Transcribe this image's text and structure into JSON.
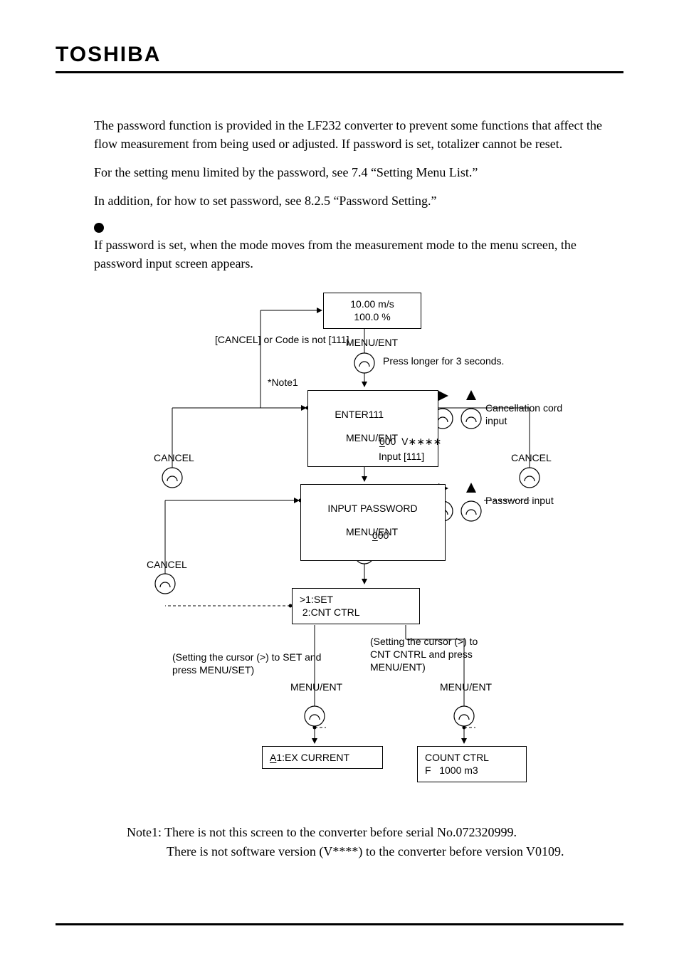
{
  "brand": "TOSHIBA",
  "para1": "The password function is provided in the LF232 converter to prevent some functions that affect the flow measurement from being used or adjusted. If password is set, totalizer cannot be reset.",
  "para2": "For the setting menu limited by the password, see 7.4 “Setting Menu List.”",
  "para3": "In addition, for how to set password, see 8.2.5 “Password Setting.”",
  "para4": "If password is set, when the mode moves from the measurement mode to the menu screen, the password input screen appears.",
  "diagram": {
    "display_top": "10.00 m/s\n100.0 %",
    "menu_ent": "MENU/ENT",
    "press_longer": "Press longer for\n3 seconds.",
    "cancel_note": "[CANCEL] or\nCode is not [111]",
    "note1_ref": "*Note1",
    "enter111": "ENTER111",
    "triple_zero": "000",
    "vstars": "V∗∗∗∗",
    "cancel_cord": "Cancellation\ncord input",
    "cancel": "CANCEL",
    "input111": "Input [111]",
    "input_password": "INPUT PASSWORD",
    "password_input": "Password\ninput",
    "menu_box": ">1:SET\n 2:CNT CTRL",
    "set_cursor_set": "(Setting the cursor (>) to SET\nand press MENU/SET)",
    "set_cursor_cnt": "(Setting the cursor (>)\nto CNT CNTRL and\npress MENU/ENT)",
    "a1_ex": "A1:EX CURRENT",
    "a1_under": "A",
    "count_ctrl": "COUNT CTRL\nF   1000 m3"
  },
  "footnote_l1": "Note1: There is not this screen to the converter before serial No.072320999.",
  "footnote_l2": "There is not software version (V****) to the converter before version V0109."
}
